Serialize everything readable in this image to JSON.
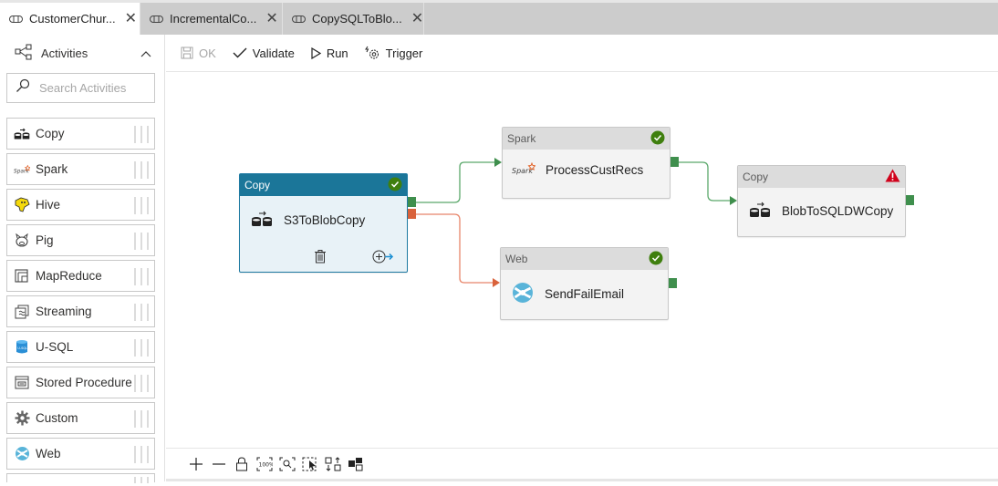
{
  "tabs": [
    {
      "label": "CustomerChur...",
      "active": true
    },
    {
      "label": "IncrementalCo...",
      "active": false
    },
    {
      "label": "CopySQLToBlo...",
      "active": false
    }
  ],
  "sidebar": {
    "header": "Activities",
    "search_placeholder": "Search Activities",
    "items": [
      {
        "label": "Copy",
        "icon": "copy-icon"
      },
      {
        "label": "Spark",
        "icon": "spark-icon"
      },
      {
        "label": "Hive",
        "icon": "hive-icon"
      },
      {
        "label": "Pig",
        "icon": "pig-icon"
      },
      {
        "label": "MapReduce",
        "icon": "mapreduce-icon"
      },
      {
        "label": "Streaming",
        "icon": "streaming-icon"
      },
      {
        "label": "U-SQL",
        "icon": "usql-icon"
      },
      {
        "label": "Stored Procedure",
        "icon": "stored-procedure-icon"
      },
      {
        "label": "Custom",
        "icon": "gear-icon"
      },
      {
        "label": "Web",
        "icon": "web-icon"
      }
    ]
  },
  "toolbar": {
    "ok_label": "OK",
    "validate_label": "Validate",
    "run_label": "Run",
    "trigger_label": "Trigger"
  },
  "nodes": {
    "s3copy": {
      "type": "Copy",
      "name": "S3ToBlobCopy",
      "status": "success",
      "selected": true
    },
    "spark": {
      "type": "Spark",
      "name": "ProcessCustRecs",
      "status": "success"
    },
    "blobcopy": {
      "type": "Copy",
      "name": "BlobToSQLDWCopy",
      "status": "warning"
    },
    "web": {
      "type": "Web",
      "name": "SendFailEmail",
      "status": "success"
    }
  },
  "edges": [
    {
      "from": "S3ToBlobCopy",
      "to": "ProcessCustRecs",
      "condition": "success",
      "color": "#5aa86a"
    },
    {
      "from": "S3ToBlobCopy",
      "to": "SendFailEmail",
      "condition": "failure",
      "color": "#d9623b"
    },
    {
      "from": "ProcessCustRecs",
      "to": "BlobToSQLDWCopy",
      "condition": "success",
      "color": "#5aa86a"
    }
  ],
  "colors": {
    "success": "#3f7f0e",
    "warning": "#d0021b",
    "selected_header": "#1b7699"
  },
  "zoom_controls": [
    "zoom-in",
    "zoom-out",
    "lock",
    "zoom-100",
    "zoom-to-fit",
    "select-mode",
    "auto-align",
    "layout"
  ]
}
